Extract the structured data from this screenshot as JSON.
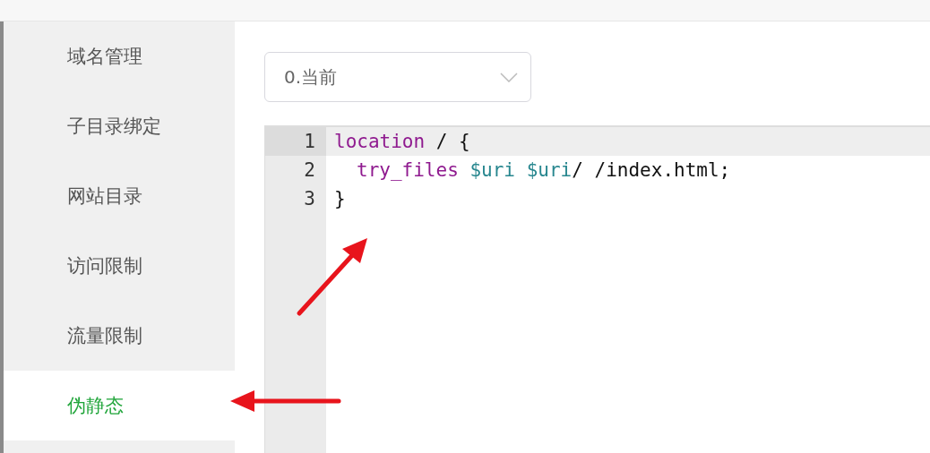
{
  "sidebar": {
    "items": [
      {
        "label": "域名管理",
        "selected": false
      },
      {
        "label": "子目录绑定",
        "selected": false
      },
      {
        "label": "网站目录",
        "selected": false
      },
      {
        "label": "访问限制",
        "selected": false
      },
      {
        "label": "流量限制",
        "selected": false
      },
      {
        "label": "伪静态",
        "selected": true
      }
    ]
  },
  "select": {
    "value": "0.当前"
  },
  "editor": {
    "lines": [
      {
        "number": "1",
        "active": true,
        "tokens": [
          {
            "kind": "keyword",
            "text": "location"
          },
          {
            "kind": "plain",
            "text": " / {"
          }
        ]
      },
      {
        "number": "2",
        "active": false,
        "indented": true,
        "tokens": [
          {
            "kind": "keyword",
            "text": "try_files"
          },
          {
            "kind": "variable",
            "text": " $uri"
          },
          {
            "kind": "variable",
            "text": " $uri"
          },
          {
            "kind": "plain",
            "text": "/ /index.html;"
          }
        ]
      },
      {
        "number": "3",
        "active": false,
        "tokens": [
          {
            "kind": "plain",
            "text": "}"
          }
        ]
      }
    ]
  }
}
